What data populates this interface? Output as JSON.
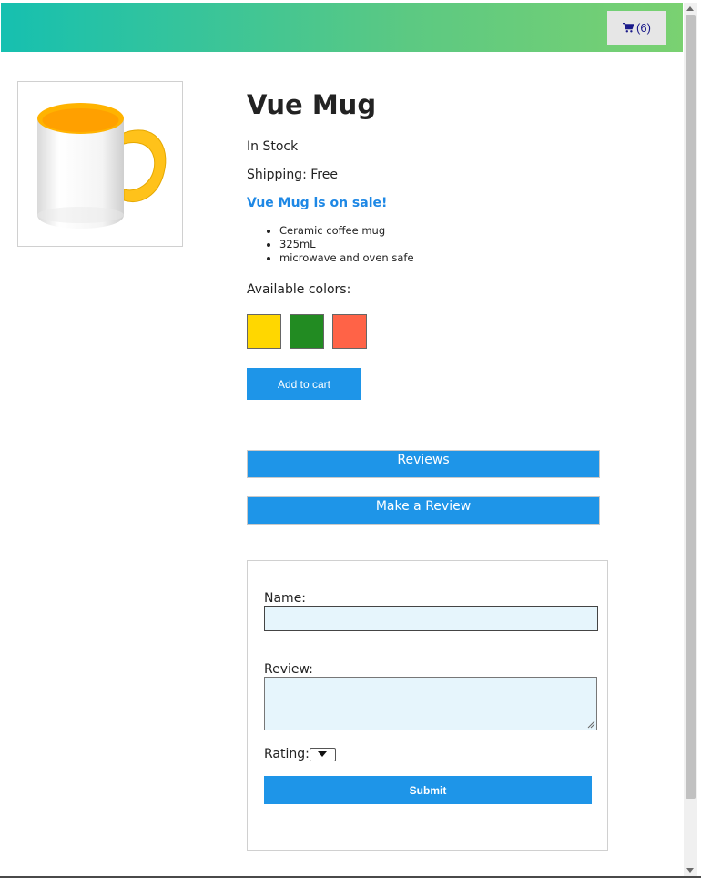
{
  "header": {
    "cart_icon": "shopping-cart-icon",
    "cart_count": "(6)",
    "gradient_start": "#16c0b0",
    "gradient_end": "#7ad171"
  },
  "product": {
    "title": "Vue Mug",
    "image_alt": "white mug with yellow interior and handle",
    "stock_status": "In Stock",
    "shipping": "Shipping: Free",
    "sale_text": "Vue Mug is on sale!",
    "details": [
      "Ceramic coffee mug",
      "325mL",
      "microwave and oven safe"
    ],
    "colors_label": "Available colors:",
    "colors": [
      "#ffd700",
      "#228b22",
      "#ff6347"
    ],
    "add_to_cart": "Add to cart"
  },
  "tabs": {
    "reviews": "Reviews",
    "make_review": "Make a Review"
  },
  "review_form": {
    "name_label": "Name:",
    "name_value": "",
    "review_label": "Review:",
    "review_value": "",
    "rating_label": "Rating:",
    "rating_value": "",
    "submit": "Submit"
  },
  "theme": {
    "accent": "#1e95e8",
    "sale_color": "#1e88e5",
    "input_bg": "#e6f5fc"
  }
}
